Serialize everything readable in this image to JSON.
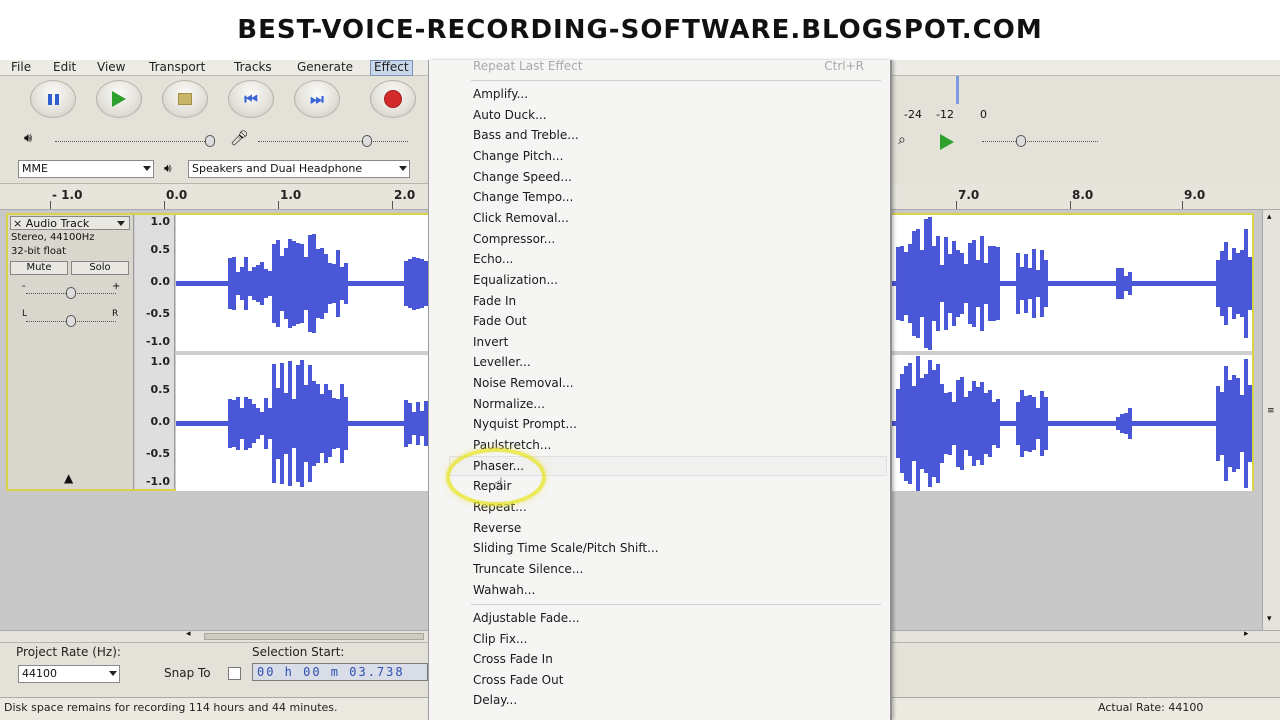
{
  "banner": {
    "text": "BEST-VOICE-RECORDING-SOFTWARE.BLOGSPOT.COM"
  },
  "menubar": {
    "items": [
      "File",
      "Edit",
      "View",
      "Transport",
      "Tracks",
      "Generate",
      "Effect"
    ],
    "active": "Effect"
  },
  "devices": {
    "host": "MME",
    "output": "Speakers and Dual Headphone"
  },
  "ruler": {
    "left_labels": [
      "- 1.0",
      "0.0",
      "1.0",
      "2.0"
    ],
    "right_labels": [
      "7.0",
      "8.0",
      "9.0"
    ]
  },
  "meter": {
    "labels": [
      "-24",
      "-12",
      "0"
    ]
  },
  "track": {
    "name": "Audio Track",
    "format": "Stereo, 44100Hz",
    "bits": "32-bit float",
    "mute": "Mute",
    "solo": "Solo",
    "slider_minus": "-",
    "slider_plus": "+",
    "pan_left": "L",
    "pan_right": "R",
    "close": "×",
    "scale": [
      "1.0",
      "0.5",
      "0.0",
      "-0.5",
      "-1.0"
    ]
  },
  "selection": {
    "project_rate_label": "Project Rate (Hz):",
    "project_rate": "44100",
    "snap_to": "Snap To",
    "selection_start_label": "Selection Start:",
    "selection_start": "00 h 00 m 03.738"
  },
  "status": {
    "disk": "Disk space remains for recording 114 hours and 44 minutes.",
    "actual_rate": "Actual Rate: 44100"
  },
  "effect_menu": {
    "repeat_last": "Repeat Last Effect",
    "repeat_last_accel": "Ctrl+R",
    "items": [
      "Amplify...",
      "Auto Duck...",
      "Bass and Treble...",
      "Change Pitch...",
      "Change Speed...",
      "Change Tempo...",
      "Click Removal...",
      "Compressor...",
      "Echo...",
      "Equalization...",
      "Fade In",
      "Fade Out",
      "Invert",
      "Leveller...",
      "Noise Removal...",
      "Normalize...",
      "Nyquist Prompt...",
      "Paulstretch...",
      "Phaser...",
      "Repair",
      "Repeat...",
      "Reverse",
      "Sliding Time Scale/Pitch Shift...",
      "Truncate Silence...",
      "Wahwah..."
    ],
    "plugins": [
      "Adjustable Fade...",
      "Clip Fix...",
      "Cross Fade In",
      "Cross Fade Out",
      "Delay..."
    ],
    "hovered": "Phaser..."
  }
}
